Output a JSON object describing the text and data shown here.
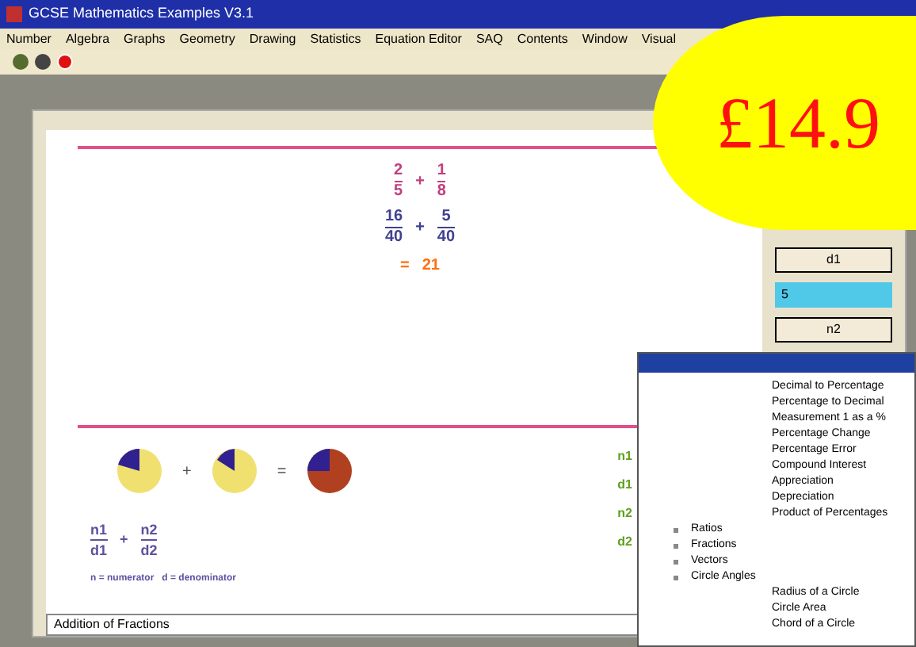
{
  "window": {
    "title": "GCSE Mathematics Examples V3.1"
  },
  "menu": [
    "Number",
    "Algebra",
    "Graphs",
    "Geometry",
    "Drawing",
    "Statistics",
    "Equation Editor",
    "SAQ",
    "Contents",
    "Window",
    "Visual"
  ],
  "worked_example": {
    "line_1": [
      {
        "n": "2",
        "d": "5"
      },
      {
        "n": "1",
        "d": "8"
      }
    ],
    "operator": "+",
    "line_2": [
      {
        "n": "16",
        "d": "40"
      },
      {
        "n": "5",
        "d": "40"
      }
    ],
    "equals": "=",
    "result": {
      "n": "21"
    },
    "pie_operator": "+",
    "pie_equals": "=",
    "formula": [
      {
        "n": "n1",
        "d": "d1"
      },
      {
        "n": "n2",
        "d": "d2"
      }
    ],
    "formula_operator": "+",
    "legend": "n = numerator   d = denominator"
  },
  "side_panel": {
    "buttons": [
      "d1",
      "n2"
    ],
    "field_value": "5",
    "labels": [
      "n1",
      "d1",
      "n2",
      "d2"
    ]
  },
  "topics": {
    "continued_children": [
      "Decimal to Percentage",
      "Percentage to Decimal",
      "Measurement 1 as a %",
      "Percentage Change",
      "Percentage Error",
      "Compound Interest",
      "Appreciation",
      "Depreciation",
      "Product of Percentages"
    ],
    "items": [
      {
        "label": "Ratios"
      },
      {
        "label": "Fractions"
      },
      {
        "label": "Vectors"
      },
      {
        "label": "Circle Angles",
        "children": [
          {
            "label": "Radius of a Circle"
          },
          {
            "label": "Circle Area"
          },
          {
            "label": "Chord of a Circle"
          }
        ]
      }
    ]
  },
  "status_bar": "Addition of Fractions",
  "price_sticker": "£14.9"
}
